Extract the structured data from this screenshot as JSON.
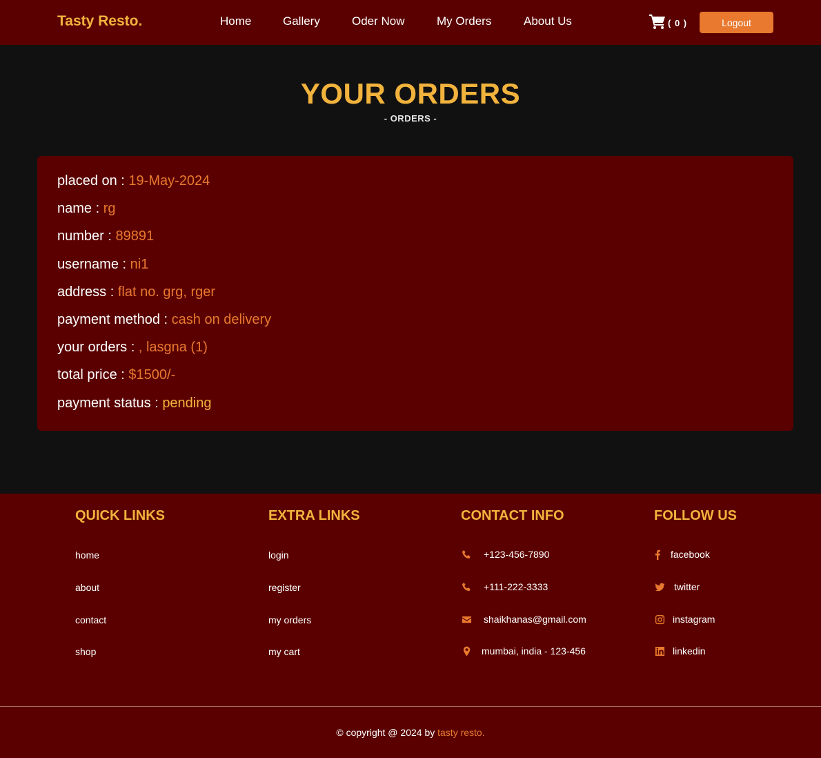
{
  "header": {
    "logo": "Tasty Resto.",
    "nav": [
      "Home",
      "Gallery",
      "Oder Now",
      "My Orders",
      "About Us"
    ],
    "cart_count": "( 0 )",
    "logout_label": "Logout"
  },
  "page": {
    "title": "YOUR ORDERS",
    "subtitle": "- ORDERS -"
  },
  "order": {
    "placed_on_label": "placed on :",
    "placed_on": "19-May-2024",
    "name_label": "name :",
    "name": "rg",
    "number_label": "number :",
    "number": "89891",
    "username_label": "username :",
    "username": "ni1",
    "address_label": "address :",
    "address": "flat no. grg, rger",
    "payment_method_label": "payment method :",
    "payment_method": "cash on delivery",
    "your_orders_label": "your orders :",
    "your_orders": ", lasgna (1)",
    "total_price_label": "total price :",
    "total_price": "$1500/-",
    "payment_status_label": "payment status :",
    "payment_status": "pending"
  },
  "footer": {
    "quick_links": {
      "title": "QUICK LINKS",
      "items": [
        "home",
        "about",
        "contact",
        "shop"
      ]
    },
    "extra_links": {
      "title": "EXTRA LINKS",
      "items": [
        "login",
        "register",
        "my orders",
        "my cart"
      ]
    },
    "contact_info": {
      "title": "CONTACT INFO",
      "items": [
        {
          "icon": "phone-icon",
          "text": "+123-456-7890"
        },
        {
          "icon": "phone-icon",
          "text": "+111-222-3333"
        },
        {
          "icon": "envelope-icon",
          "text": "shaikhanas@gmail.com"
        },
        {
          "icon": "map-marker-icon",
          "text": "mumbai, india - 123-456"
        }
      ]
    },
    "follow_us": {
      "title": "FOLLOW US",
      "items": [
        {
          "icon": "facebook-icon",
          "text": "facebook"
        },
        {
          "icon": "twitter-icon",
          "text": "twitter"
        },
        {
          "icon": "instagram-icon",
          "text": "instagram"
        },
        {
          "icon": "linkedin-icon",
          "text": "linkedin"
        }
      ]
    },
    "copyright_prefix": "© copyright @ 2024 by ",
    "copyright_brand": "tasty resto."
  },
  "colors": {
    "header_bg": "#5a0000",
    "page_bg": "#111111",
    "accent_yellow": "#f2b33d",
    "accent_orange": "#e9792f"
  }
}
